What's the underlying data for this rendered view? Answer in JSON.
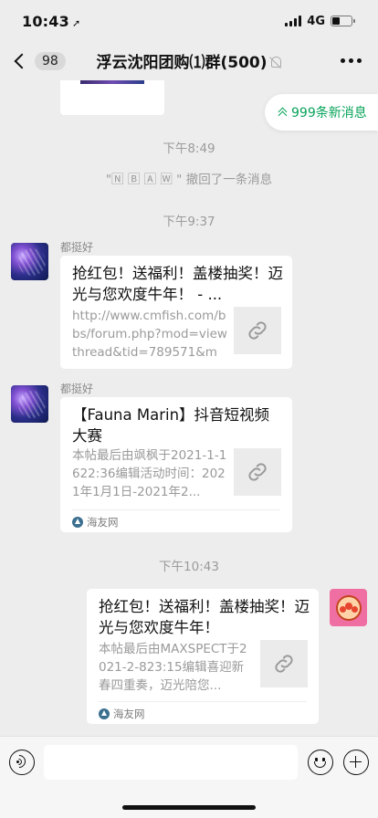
{
  "status_bar": {
    "time": "10:43",
    "location_glyph": "➚",
    "network": "4G"
  },
  "nav": {
    "back_badge": "98",
    "title": "浮云沈阳团购⑴群(500)",
    "icons": [
      "back-chevron-icon",
      "mute-bell-icon",
      "more-dots-icon"
    ]
  },
  "new_messages": {
    "label": "999条新消息"
  },
  "timeline": {
    "t1": "下午8:49",
    "recall": "\"🄽 🄱 🄰 🅆 \" 撤回了一条消息",
    "t2": "下午9:37",
    "t3": "下午10:43"
  },
  "messages": [
    {
      "sender": "都挺好",
      "title": "抢红包！送福利！盖楼抽奖！迈光与您欢度牛年！ - ...",
      "desc": "http://www.cmfish.com/bbs/forum.php?mod=viewthread&tid=789571&mo..."
    },
    {
      "sender": "都挺好",
      "title": "【Fauna Marin】抖音短视频大赛",
      "desc": "本帖最后由飒枫于2021-1-1622:36编辑活动时间：2021年1月1日-2021年2...",
      "source": "海友网"
    },
    {
      "sender": "",
      "title": "抢红包！送福利！盖楼抽奖！迈光与您欢度牛年！",
      "desc": "本帖最后由MAXSPECT于2021-2-823:15编辑喜迎新春四重奏，迈光陪您...",
      "source": "海友网"
    }
  ],
  "input_bar": {
    "placeholder": "",
    "icons": [
      "voice-icon",
      "emoji-icon",
      "plus-icon"
    ]
  },
  "colors": {
    "accent_green": "#07a35a",
    "background": "#ededed"
  }
}
